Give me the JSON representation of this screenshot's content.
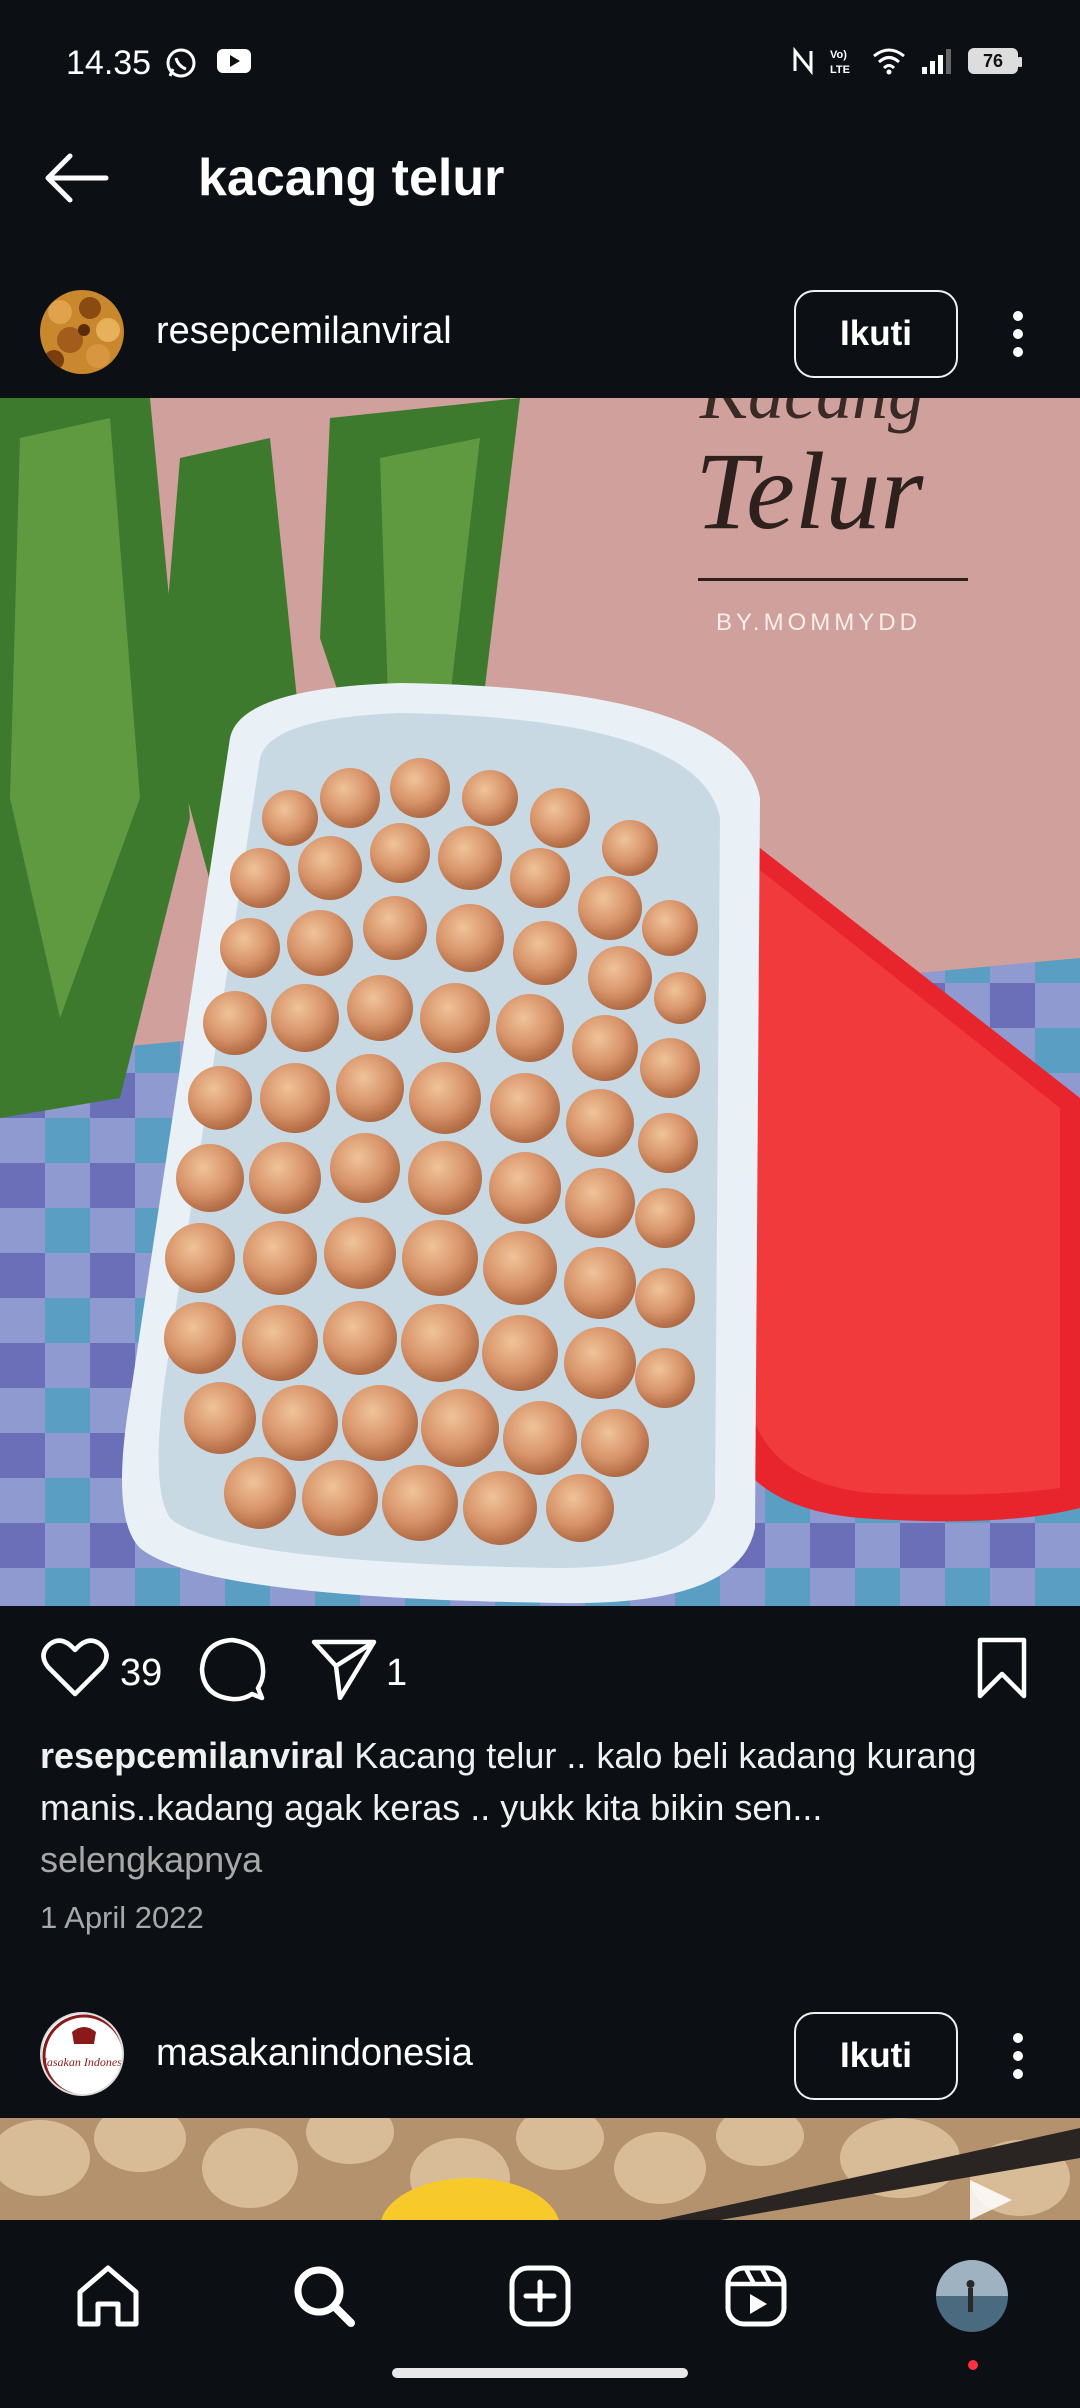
{
  "status_bar": {
    "time": "14.35",
    "left_icons": [
      "whatsapp-icon",
      "youtube-icon"
    ],
    "right_icons": [
      "nfc-icon",
      "volte-icon",
      "wifi-icon",
      "signal-icon"
    ],
    "battery": "76"
  },
  "header": {
    "title": "kacang telur"
  },
  "posts": [
    {
      "username": "resepcemilanviral",
      "follow_label": "Ikuti",
      "image_overlay": {
        "line1": "Kacang",
        "line2": "Telur",
        "credit": "BY.MOMMYDD"
      },
      "likes": "39",
      "shares": "1",
      "caption_user": "resepcemilanviral",
      "caption_text": " Kacang telur .. kalo beli kadang kurang manis..kadang agak keras .. yukk kita bikin sen...",
      "more_label": "selengkapnya",
      "date": "1 April 2022"
    },
    {
      "username": "masakanindonesia",
      "follow_label": "Ikuti",
      "avatar_text": "Masakan Indonesia"
    }
  ],
  "bottom_nav": [
    "home-icon",
    "search-icon",
    "create-icon",
    "reels-icon",
    "profile-avatar"
  ],
  "colors": {
    "background": "#0c1014",
    "text": "#f5f5f5",
    "muted": "#a8a8a8",
    "notification_dot": "#ff3040"
  }
}
